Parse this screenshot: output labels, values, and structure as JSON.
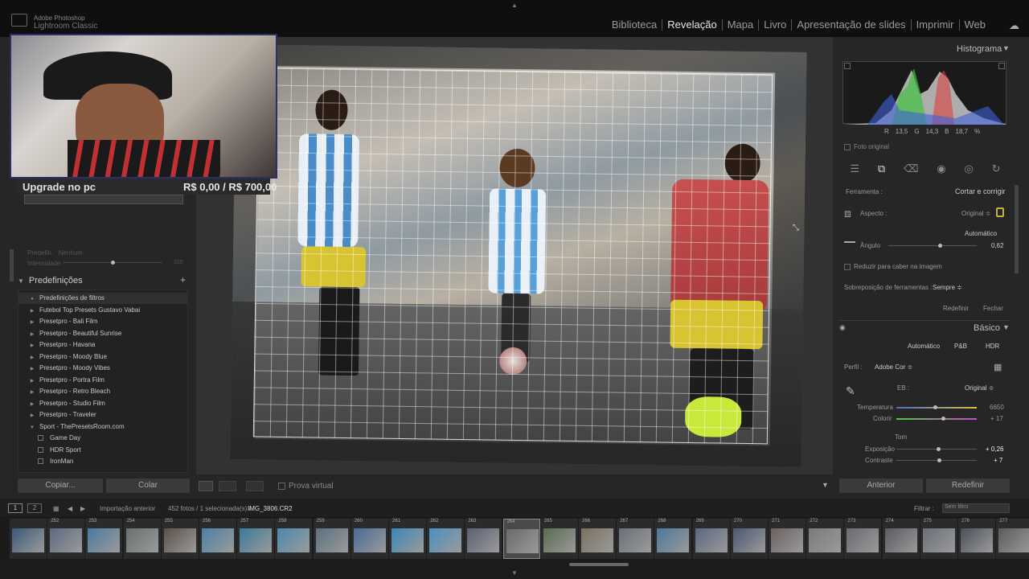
{
  "app": {
    "brand_line1": "Adobe Photoshop",
    "brand_line2": "Lightroom Classic"
  },
  "modules": [
    "Biblioteca",
    "Revelação",
    "Mapa",
    "Livro",
    "Apresentação de slides",
    "Imprimir",
    "Web"
  ],
  "overlay": {
    "upgrade_label": "Upgrade no pc",
    "upgrade_amount": "R$ 0,00 / R$ 700,00"
  },
  "left": {
    "predefinicao_label": "Predefin.",
    "predefinicao_value": "Nenhum",
    "intensidade_label": "Intensidade",
    "intensidade_max": "100",
    "presets_title": "Predefinições",
    "presets": [
      {
        "label": "Predefinições de filtros",
        "kind": "filter"
      },
      {
        "label": "Futebol Top Presets Gustavo Vabai",
        "kind": "folder"
      },
      {
        "label": "Presetpro - Bali Film",
        "kind": "folder"
      },
      {
        "label": "Presetpro - Beautiful Sunrise",
        "kind": "folder"
      },
      {
        "label": "Presetpro - Havana",
        "kind": "folder"
      },
      {
        "label": "Presetpro - Moody Blue",
        "kind": "folder"
      },
      {
        "label": "Presetpro - Moody Vibes",
        "kind": "folder"
      },
      {
        "label": "Presetpro - Portra Film",
        "kind": "folder"
      },
      {
        "label": "Presetpro - Retro Bleach",
        "kind": "folder"
      },
      {
        "label": "Presetpro - Studio Film",
        "kind": "folder"
      },
      {
        "label": "Presetpro - Traveler",
        "kind": "folder"
      },
      {
        "label": "Sport - ThePresetsRoom.com",
        "kind": "open"
      },
      {
        "label": "Game Day",
        "kind": "item"
      },
      {
        "label": "HDR Sport",
        "kind": "item"
      },
      {
        "label": "IronMan",
        "kind": "item"
      }
    ],
    "copy_btn": "Copiar...",
    "paste_btn": "Colar"
  },
  "toolbar": {
    "soft_proof": "Prova virtual"
  },
  "right": {
    "histogram_title": "Histograma",
    "rgb": {
      "r_label": "R",
      "r": "13,5",
      "g_label": "G",
      "g": "14,3",
      "b_label": "B",
      "b": "18,7",
      "unit": "%"
    },
    "original_photo": "Foto original",
    "tool_label": "Ferramenta :",
    "tool_name": "Cortar e corrigir",
    "aspect_label": "Aspecto :",
    "aspect_value": "Original ≑",
    "auto_label": "Automático",
    "angle_label": "Ângulo",
    "angle_value": "0,62",
    "angle_pos": 0.58,
    "constrain_label": "Reduzir para caber na imagem",
    "overlay_label": "Sobreposição de ferramentas :",
    "overlay_value": "Sempre ≑",
    "reset_small": "Redefinir",
    "close_small": "Fechar",
    "basic_title": "Básico",
    "treat_auto": "Automático",
    "treat_bw": "P&B",
    "treat_hdr": "HDR",
    "profile_label": "Perfil :",
    "profile_value": "Adobe Cor ≑",
    "wb_label": "EB :",
    "wb_value": "Original ≑",
    "temp_label": "Temperatura",
    "temp_value": "6650",
    "temp_pos": 0.48,
    "tint_label": "Colorir",
    "tint_value": "+ 17",
    "tint_pos": 0.58,
    "tone_label": "Tom",
    "exposure_label": "Exposição",
    "exposure_value": "+ 0,26",
    "exposure_pos": 0.52,
    "contrast_label": "Contraste",
    "contrast_value": "+ 7",
    "contrast_pos": 0.53,
    "prev_btn": "Anterior",
    "reset_btn": "Redefinir",
    "colors": {
      "accent_red": "#d84040",
      "accent_green": "#40c040",
      "accent_blue": "#4060d8"
    }
  },
  "filmbar": {
    "page1": "1",
    "page2": "2",
    "source": "Importação anterior",
    "count": "452 fotos / 1 selecionada(s) /",
    "filename": "IMG_3806.CR2",
    "filter_label": "Filtrar :",
    "filter_value": "Sem filtro"
  },
  "filmstrip": [
    "",
    "252",
    "253",
    "254",
    "255",
    "256",
    "257",
    "258",
    "259",
    "260",
    "261",
    "262",
    "263",
    "264",
    "265",
    "266",
    "267",
    "268",
    "269",
    "270",
    "271",
    "272",
    "273",
    "274",
    "275",
    "276",
    "277"
  ],
  "filmstrip_selected": "264"
}
